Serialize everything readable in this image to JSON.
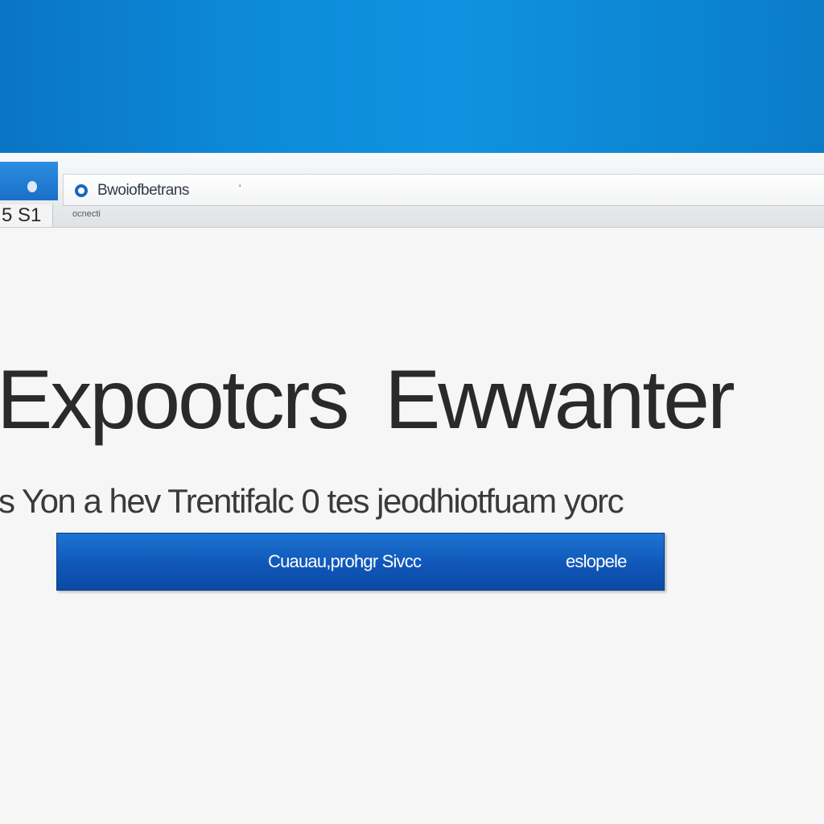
{
  "header": {
    "color": "#0c8ad8"
  },
  "browser": {
    "side_label": "5 S1",
    "tab_title": "Bwoiofbetrans",
    "tab_close_glyph": "'",
    "sub_label": "ocnecti",
    "tab_icon": "globe-icon"
  },
  "hero": {
    "headline_left": "Expootcrs",
    "headline_right": "Ewwanter",
    "subtitle": "s Yon a hev Trentifalc 0 tes jeodhiotfuam yorc"
  },
  "cta": {
    "label": "Cuauau,prohgr Sivcc",
    "right_label": "eslopele",
    "color": "#1057b8"
  }
}
